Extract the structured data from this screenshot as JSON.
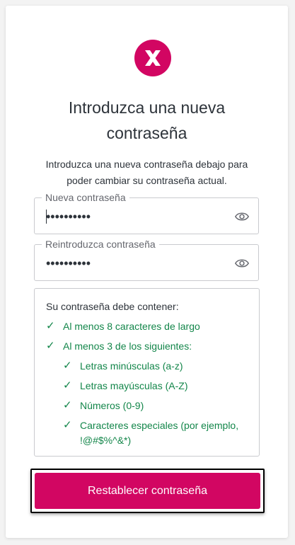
{
  "brand": {
    "accent_color": "#d20662",
    "success_color": "#13864a",
    "logo_icon": "x-logo-icon"
  },
  "header": {
    "title_line1": "Introduzca una nueva",
    "title_line2": "contraseña",
    "description_line1": "Introduzca una nueva contraseña debajo para",
    "description_line2": "poder cambiar su contraseña actual."
  },
  "form": {
    "new_password": {
      "label": "Nueva contraseña",
      "value": "••••••••••",
      "toggle_icon": "eye-icon"
    },
    "confirm_password": {
      "label": "Reintroduzca contraseña",
      "value": "••••••••••",
      "toggle_icon": "eye-icon"
    }
  },
  "requirements": {
    "title": "Su contraseña debe contener:",
    "check_symbol": "✓",
    "items": [
      "Al menos 8 caracteres de largo",
      "Al menos 3 de los siguientes:"
    ],
    "sub_items": [
      "Letras minúsculas (a-z)",
      "Letras mayúsculas (A-Z)",
      "Números (0-9)",
      "Caracteres especiales (por ejemplo,",
      "!@#$%^&*)"
    ]
  },
  "actions": {
    "submit_label": "Restablecer contraseña"
  }
}
